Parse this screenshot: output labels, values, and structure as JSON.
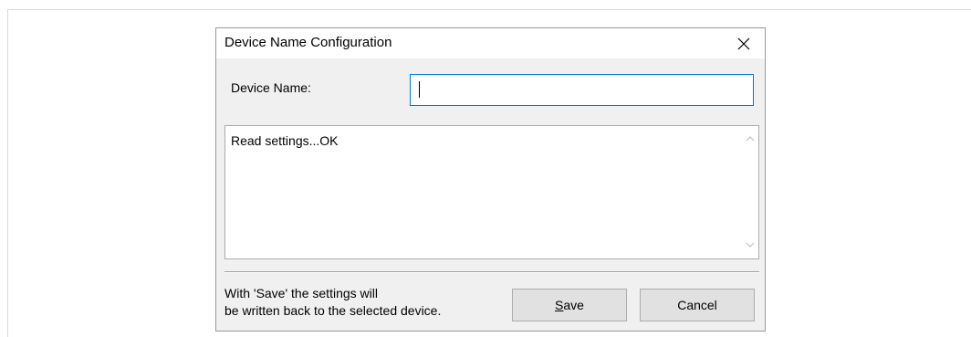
{
  "dialog": {
    "title": "Device Name Configuration",
    "close_glyph": "×"
  },
  "form": {
    "device_name_label": "Device Name:",
    "device_name_value": ""
  },
  "log": {
    "text": "Read settings...OK"
  },
  "footer": {
    "hint_line1": "With 'Save' the settings will",
    "hint_line2": "be written back to the selected device."
  },
  "buttons": {
    "save_accel": "S",
    "save_rest": "ave",
    "cancel_label": "Cancel"
  },
  "colors": {
    "dialog_bg": "#f0f0f0",
    "focus_border": "#0078d7",
    "button_bg": "#e1e1e1"
  },
  "icons": {
    "close": "close-icon",
    "scroll_up": "chevron-up-icon",
    "scroll_down": "chevron-down-icon"
  }
}
